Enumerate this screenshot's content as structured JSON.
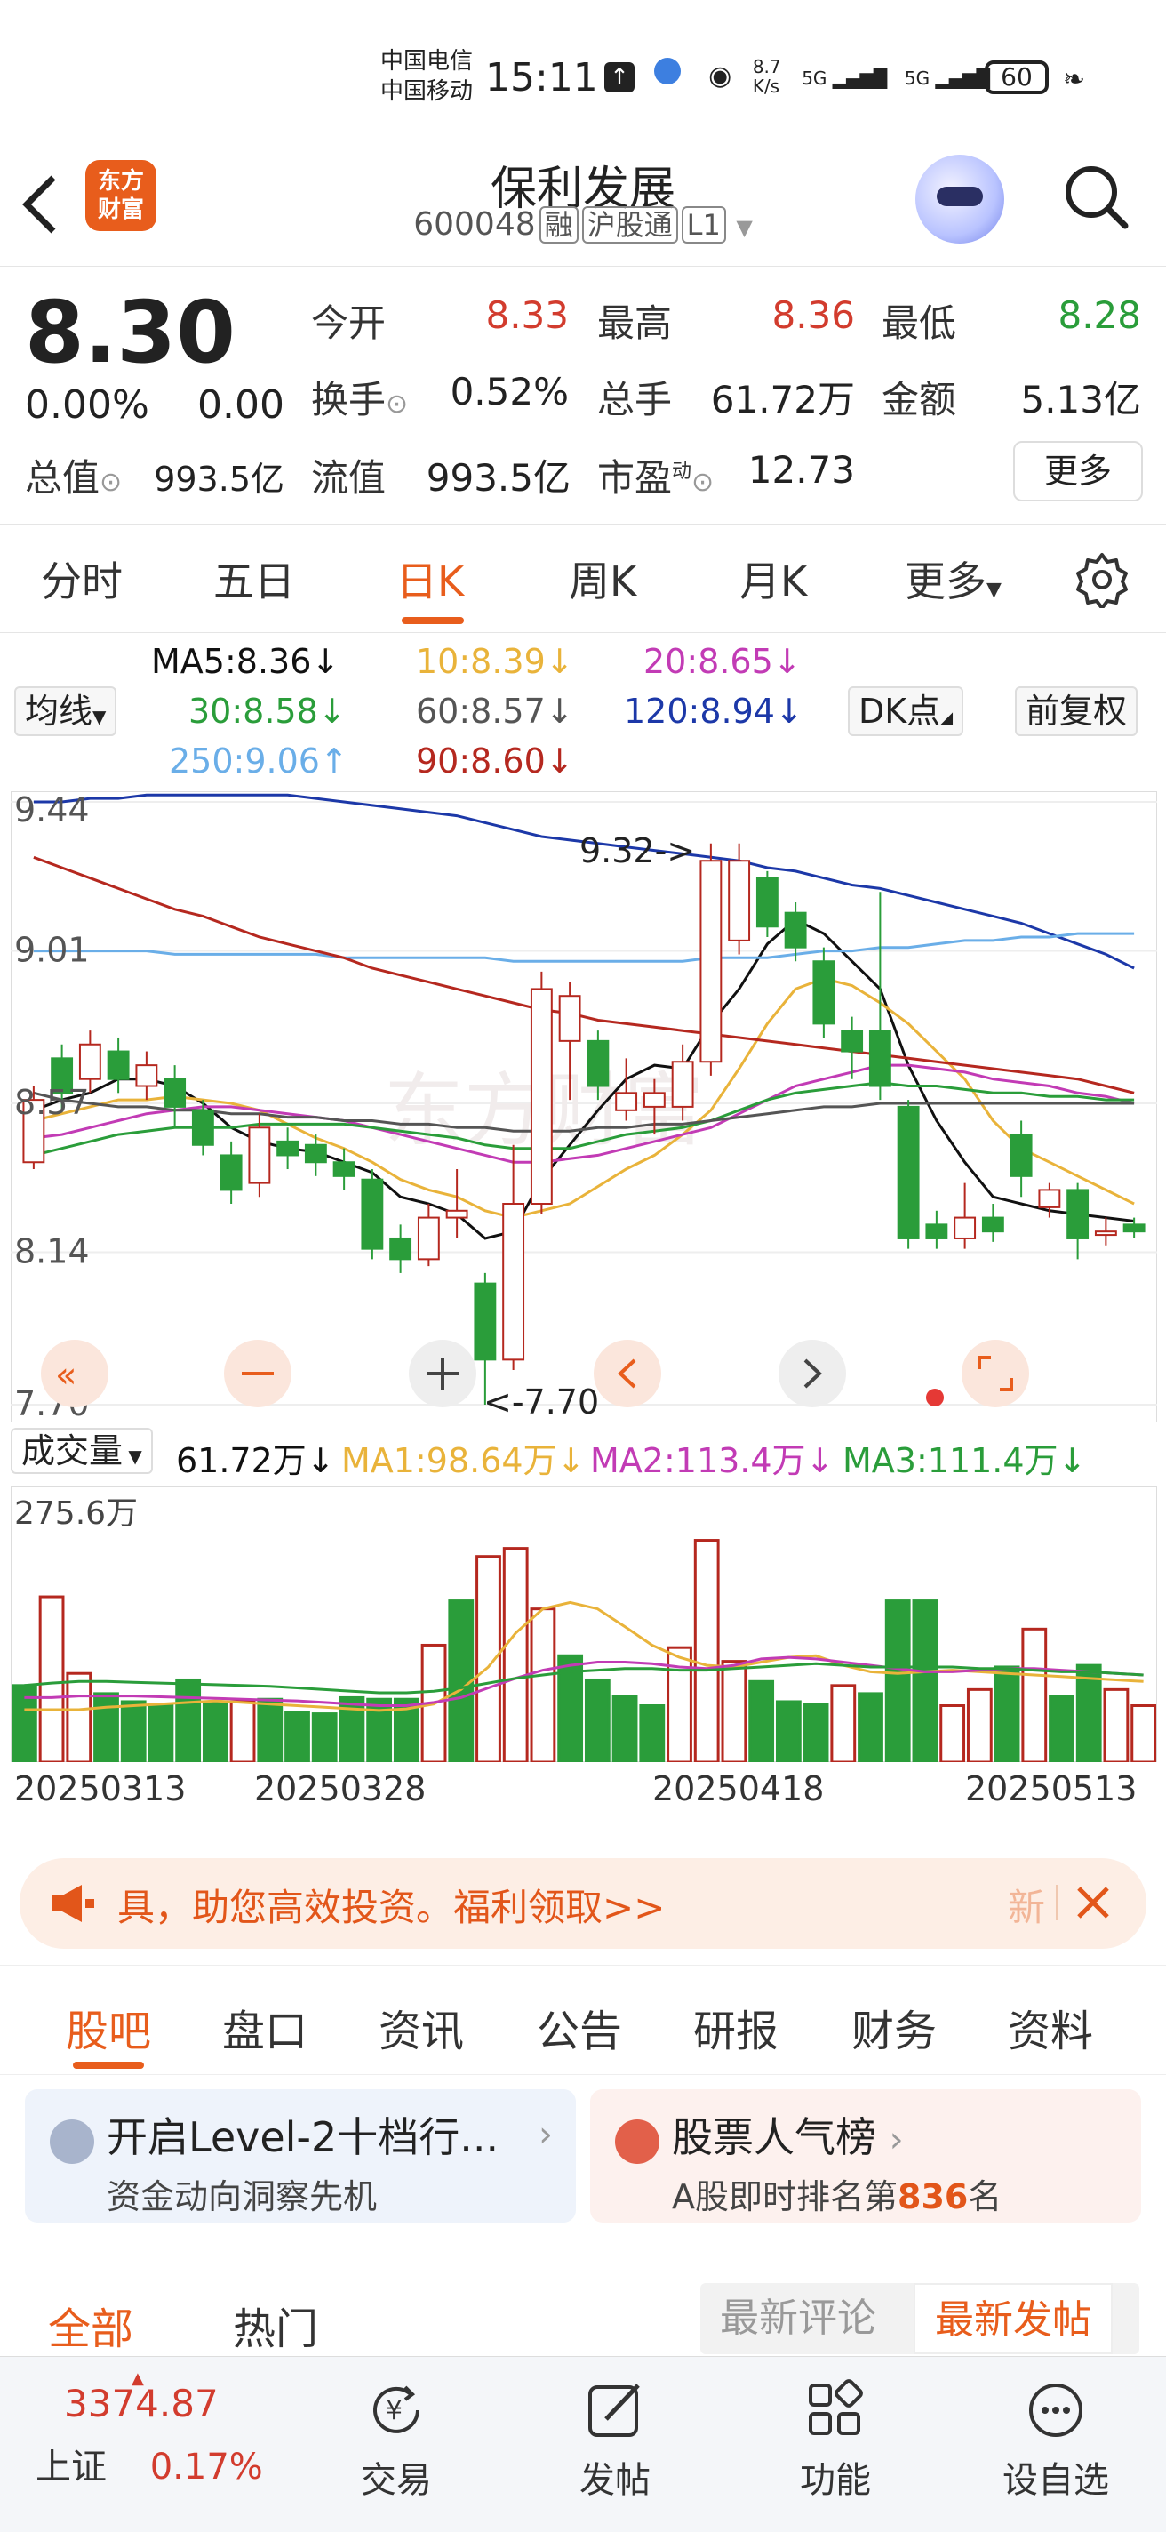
{
  "status_bar": {
    "carrier1": "中国电信",
    "carrier2": "中国移动",
    "time": "15:11",
    "net_speed_value": "8.7",
    "net_speed_unit": "K/s",
    "signal1": "5G",
    "signal2": "5G",
    "battery": "60"
  },
  "header": {
    "logo_line1": "东方",
    "logo_line2": "财富",
    "title": "保利发展",
    "code": "600048",
    "tags": [
      "融",
      "沪股通",
      "L1"
    ]
  },
  "quote": {
    "price": "8.30",
    "change_pct": "0.00%",
    "change_val": "0.00",
    "open_label": "今开",
    "open": "8.33",
    "high_label": "最高",
    "high": "8.36",
    "low_label": "最低",
    "low": "8.28",
    "turnover_label": "换手",
    "turnover": "0.52%",
    "volume_label": "总手",
    "volume": "61.72万",
    "amount_label": "金额",
    "amount": "5.13亿",
    "total_value_label": "总值",
    "total_value": "993.5亿",
    "float_value_label": "流值",
    "float_value": "993.5亿",
    "pe_label": "市盈",
    "pe_sup": "动",
    "pe": "12.73",
    "more": "更多"
  },
  "period_tabs": [
    "分时",
    "五日",
    "日K",
    "周K",
    "月K",
    "更多"
  ],
  "active_period": "日K",
  "ma_legend": {
    "ma_button": "均线",
    "ma5": "MA5:8.36↓",
    "ma10": "10:8.39↓",
    "ma20": "20:8.65↓",
    "ma30": "30:8.58↓",
    "ma60": "60:8.57↓",
    "ma120": "120:8.94↓",
    "ma250": "250:9.06↑",
    "ma90": "90:8.60↓",
    "dk_button": "DK点",
    "adjust_button": "前复权",
    "colors": {
      "ma5": "#111111",
      "ma10": "#e9b33a",
      "ma20": "#c23bb5",
      "ma30": "#2a9d3a",
      "ma60": "#555555",
      "ma120": "#1c38a8",
      "ma250": "#6aaee8",
      "ma90": "#b5281f"
    }
  },
  "chart_data": [
    {
      "type": "candlestick",
      "title": "",
      "y_ticks": [
        "9.44",
        "9.01",
        "8.57",
        "8.14",
        "7.70"
      ],
      "ylim": [
        7.7,
        9.44
      ],
      "annotations": {
        "high_mark": "9.32->",
        "low_mark": "<-7.70"
      },
      "candles": [
        {
          "o": 8.4,
          "c": 8.58,
          "h": 8.62,
          "l": 8.38
        },
        {
          "o": 8.7,
          "c": 8.6,
          "h": 8.74,
          "l": 8.55
        },
        {
          "o": 8.64,
          "c": 8.74,
          "h": 8.78,
          "l": 8.6
        },
        {
          "o": 8.72,
          "c": 8.64,
          "h": 8.76,
          "l": 8.6
        },
        {
          "o": 8.62,
          "c": 8.68,
          "h": 8.72,
          "l": 8.58
        },
        {
          "o": 8.64,
          "c": 8.56,
          "h": 8.68,
          "l": 8.5
        },
        {
          "o": 8.55,
          "c": 8.45,
          "h": 8.58,
          "l": 8.42
        },
        {
          "o": 8.42,
          "c": 8.32,
          "h": 8.46,
          "l": 8.28
        },
        {
          "o": 8.34,
          "c": 8.5,
          "h": 8.54,
          "l": 8.3
        },
        {
          "o": 8.46,
          "c": 8.42,
          "h": 8.5,
          "l": 8.38
        },
        {
          "o": 8.45,
          "c": 8.4,
          "h": 8.48,
          "l": 8.36
        },
        {
          "o": 8.4,
          "c": 8.36,
          "h": 8.44,
          "l": 8.32
        },
        {
          "o": 8.35,
          "c": 8.15,
          "h": 8.38,
          "l": 8.12
        },
        {
          "o": 8.18,
          "c": 8.12,
          "h": 8.22,
          "l": 8.08
        },
        {
          "o": 8.12,
          "c": 8.24,
          "h": 8.28,
          "l": 8.1
        },
        {
          "o": 8.24,
          "c": 8.26,
          "h": 8.38,
          "l": 8.18
        },
        {
          "o": 8.05,
          "c": 7.83,
          "h": 8.08,
          "l": 7.7
        },
        {
          "o": 7.83,
          "c": 8.28,
          "h": 8.45,
          "l": 7.8
        },
        {
          "o": 8.28,
          "c": 8.9,
          "h": 8.95,
          "l": 8.25
        },
        {
          "o": 8.75,
          "c": 8.88,
          "h": 8.92,
          "l": 8.58
        },
        {
          "o": 8.75,
          "c": 8.62,
          "h": 8.78,
          "l": 8.58
        },
        {
          "o": 8.55,
          "c": 8.6,
          "h": 8.7,
          "l": 8.52
        },
        {
          "o": 8.56,
          "c": 8.6,
          "h": 8.64,
          "l": 8.48
        },
        {
          "o": 8.56,
          "c": 8.69,
          "h": 8.74,
          "l": 8.52
        },
        {
          "o": 8.69,
          "c": 9.27,
          "h": 9.32,
          "l": 8.65
        },
        {
          "o": 9.04,
          "c": 9.27,
          "h": 9.32,
          "l": 9.0
        },
        {
          "o": 9.22,
          "c": 9.08,
          "h": 9.24,
          "l": 9.05
        },
        {
          "o": 9.12,
          "c": 9.02,
          "h": 9.15,
          "l": 8.98
        },
        {
          "o": 8.98,
          "c": 8.8,
          "h": 9.02,
          "l": 8.76
        },
        {
          "o": 8.78,
          "c": 8.72,
          "h": 8.82,
          "l": 8.64
        },
        {
          "o": 8.78,
          "c": 8.62,
          "h": 9.18,
          "l": 8.58
        },
        {
          "o": 8.56,
          "c": 8.18,
          "h": 8.58,
          "l": 8.15
        },
        {
          "o": 8.22,
          "c": 8.18,
          "h": 8.26,
          "l": 8.15
        },
        {
          "o": 8.18,
          "c": 8.24,
          "h": 8.34,
          "l": 8.15
        },
        {
          "o": 8.24,
          "c": 8.2,
          "h": 8.28,
          "l": 8.17
        },
        {
          "o": 8.48,
          "c": 8.36,
          "h": 8.52,
          "l": 8.3
        },
        {
          "o": 8.27,
          "c": 8.32,
          "h": 8.34,
          "l": 8.24
        },
        {
          "o": 8.32,
          "c": 8.18,
          "h": 8.34,
          "l": 8.12
        },
        {
          "o": 8.19,
          "c": 8.2,
          "h": 8.24,
          "l": 8.16
        },
        {
          "o": 8.22,
          "c": 8.2,
          "h": 8.24,
          "l": 8.18
        }
      ],
      "ma_lines": {
        "ma5": [
          8.55,
          8.58,
          8.6,
          8.64,
          8.64,
          8.62,
          8.57,
          8.5,
          8.46,
          8.44,
          8.43,
          8.4,
          8.37,
          8.3,
          8.28,
          8.25,
          8.18,
          8.2,
          8.35,
          8.45,
          8.55,
          8.64,
          8.68,
          8.67,
          8.8,
          8.9,
          9.03,
          9.1,
          9.06,
          8.98,
          8.9,
          8.68,
          8.52,
          8.4,
          8.3,
          8.28,
          8.26,
          8.25,
          8.24,
          8.23
        ],
        "ma10": [
          8.52,
          8.54,
          8.56,
          8.58,
          8.58,
          8.59,
          8.58,
          8.57,
          8.55,
          8.51,
          8.47,
          8.44,
          8.4,
          8.35,
          8.32,
          8.3,
          8.26,
          8.24,
          8.26,
          8.28,
          8.33,
          8.38,
          8.42,
          8.48,
          8.55,
          8.67,
          8.8,
          8.9,
          8.93,
          8.91,
          8.86,
          8.8,
          8.72,
          8.64,
          8.52,
          8.44,
          8.4,
          8.36,
          8.32,
          8.28
        ],
        "ma20": [
          8.47,
          8.48,
          8.5,
          8.52,
          8.54,
          8.55,
          8.56,
          8.56,
          8.55,
          8.54,
          8.53,
          8.52,
          8.5,
          8.48,
          8.46,
          8.44,
          8.42,
          8.4,
          8.4,
          8.41,
          8.42,
          8.44,
          8.46,
          8.48,
          8.5,
          8.54,
          8.58,
          8.62,
          8.64,
          8.66,
          8.68,
          8.68,
          8.67,
          8.66,
          8.64,
          8.63,
          8.62,
          8.6,
          8.59,
          8.57
        ],
        "ma30": [
          8.42,
          8.44,
          8.46,
          8.48,
          8.49,
          8.5,
          8.5,
          8.5,
          8.51,
          8.51,
          8.51,
          8.51,
          8.5,
          8.49,
          8.48,
          8.47,
          8.45,
          8.44,
          8.44,
          8.44,
          8.46,
          8.48,
          8.49,
          8.5,
          8.52,
          8.55,
          8.58,
          8.6,
          8.61,
          8.62,
          8.63,
          8.62,
          8.62,
          8.61,
          8.6,
          8.6,
          8.59,
          8.59,
          8.58,
          8.58
        ],
        "ma60": [
          8.6,
          8.58,
          8.57,
          8.56,
          8.56,
          8.55,
          8.55,
          8.54,
          8.54,
          8.53,
          8.53,
          8.52,
          8.52,
          8.51,
          8.51,
          8.5,
          8.5,
          8.49,
          8.49,
          8.49,
          8.5,
          8.5,
          8.51,
          8.51,
          8.52,
          8.53,
          8.54,
          8.55,
          8.56,
          8.56,
          8.57,
          8.57,
          8.57,
          8.57,
          8.57,
          8.57,
          8.57,
          8.57,
          8.57,
          8.57
        ],
        "ma120": [
          9.44,
          9.44,
          9.45,
          9.45,
          9.46,
          9.46,
          9.46,
          9.46,
          9.46,
          9.46,
          9.45,
          9.44,
          9.43,
          9.42,
          9.41,
          9.4,
          9.38,
          9.36,
          9.34,
          9.33,
          9.32,
          9.31,
          9.3,
          9.29,
          9.28,
          9.27,
          9.25,
          9.24,
          9.22,
          9.2,
          9.19,
          9.17,
          9.15,
          9.13,
          9.11,
          9.09,
          9.06,
          9.03,
          9.0,
          8.96
        ],
        "ma250": [
          9.01,
          9.01,
          9.01,
          9.01,
          9.01,
          9.0,
          9.0,
          9.0,
          9.0,
          9.0,
          9.0,
          8.99,
          8.99,
          8.99,
          8.99,
          8.99,
          8.99,
          8.98,
          8.98,
          8.98,
          8.98,
          8.98,
          8.98,
          8.98,
          8.99,
          8.99,
          8.99,
          9.0,
          9.01,
          9.01,
          9.02,
          9.02,
          9.03,
          9.04,
          9.04,
          9.05,
          9.05,
          9.06,
          9.06,
          9.06
        ],
        "ma90": [
          9.28,
          9.25,
          9.22,
          9.19,
          9.16,
          9.13,
          9.11,
          9.08,
          9.05,
          9.03,
          9.01,
          8.99,
          8.96,
          8.94,
          8.92,
          8.9,
          8.88,
          8.86,
          8.84,
          8.83,
          8.81,
          8.8,
          8.79,
          8.78,
          8.77,
          8.76,
          8.75,
          8.74,
          8.73,
          8.72,
          8.71,
          8.7,
          8.69,
          8.68,
          8.67,
          8.66,
          8.65,
          8.64,
          8.62,
          8.6
        ]
      }
    },
    {
      "type": "bar",
      "title": "",
      "y_ticks": [
        "275.6万"
      ],
      "ylim": [
        0,
        275.6
      ],
      "values": [
        95,
        205,
        110,
        85,
        75,
        72,
        102,
        74,
        75,
        78,
        62,
        60,
        80,
        78,
        78,
        145,
        200,
        255,
        265,
        190,
        132,
        102,
        82,
        70,
        142,
        275,
        125,
        100,
        75,
        72,
        95,
        85,
        200,
        200,
        70,
        90,
        118,
        165,
        82,
        120,
        90,
        70
      ],
      "up": [
        0,
        1,
        1,
        0,
        0,
        0,
        0,
        0,
        1,
        0,
        0,
        0,
        0,
        0,
        0,
        1,
        0,
        1,
        1,
        1,
        0,
        0,
        0,
        0,
        1,
        1,
        1,
        0,
        0,
        0,
        1,
        0,
        0,
        0,
        1,
        1,
        0,
        1,
        0,
        0,
        1,
        1
      ],
      "ma_lines": {
        "ma1": [
          65,
          65,
          65,
          68,
          70,
          72,
          74,
          76,
          74,
          72,
          70,
          68,
          66,
          64,
          66,
          72,
          90,
          118,
          160,
          190,
          198,
          190,
          168,
          145,
          130,
          120,
          118,
          124,
          130,
          132,
          120,
          112,
          110,
          112,
          114,
          112,
          110,
          108,
          106,
          104,
          102,
          100
        ],
        "ma2": [
          80,
          80,
          82,
          82,
          82,
          81,
          80,
          79,
          78,
          77,
          76,
          74,
          72,
          70,
          70,
          74,
          80,
          92,
          104,
          114,
          120,
          124,
          124,
          122,
          118,
          116,
          120,
          128,
          130,
          128,
          124,
          120,
          116,
          112,
          112,
          114,
          116,
          116,
          114,
          112,
          110,
          108
        ],
        "ma3": [
          95,
          98,
          100,
          100,
          99,
          98,
          97,
          96,
          95,
          94,
          92,
          90,
          88,
          86,
          86,
          88,
          92,
          98,
          104,
          108,
          112,
          114,
          116,
          116,
          114,
          114,
          116,
          118,
          120,
          122,
          120,
          118,
          118,
          118,
          118,
          116,
          116,
          114,
          112,
          112,
          110,
          108
        ]
      }
    }
  ],
  "volume_legend": {
    "button": "成交量",
    "value": "61.72万↓",
    "ma1": "MA1:98.64万↓",
    "ma2": "MA2:113.4万↓",
    "ma3": "MA3:111.4万↓",
    "colors": {
      "ma1": "#e9b33a",
      "ma2": "#c23bb5",
      "ma3": "#2a9d3a"
    }
  },
  "dates": [
    "20250313",
    "20250328",
    "20250418",
    "20250513"
  ],
  "watermark": "东方财富",
  "ad": {
    "text": "具，助您高效投资。福利领取>>",
    "tail": "新"
  },
  "section_tabs": [
    "股吧",
    "盘口",
    "资讯",
    "公告",
    "研报",
    "财务",
    "资料"
  ],
  "active_section": "股吧",
  "cards": {
    "left_title": "开启Level-2十档行...",
    "left_sub": "资金动向洞察先机",
    "right_title": "股票人气榜",
    "right_sub_pre": "A股即时排名第",
    "right_rank": "836",
    "right_sub_post": "名"
  },
  "feed_tabs": {
    "all": "全部",
    "hot": "热门",
    "latest_comments": "最新评论",
    "latest_posts": "最新发帖"
  },
  "bottom_bar": {
    "index_value": "3374.87",
    "index_name": "上证",
    "index_change": "0.17%",
    "trade": "交易",
    "post": "发帖",
    "function": "功能",
    "watchlist": "设自选"
  }
}
